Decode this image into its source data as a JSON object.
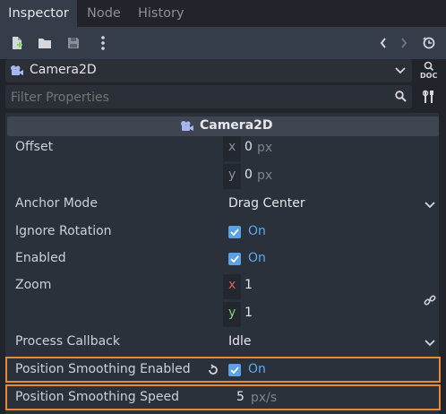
{
  "tabs": [
    {
      "label": "Inspector"
    },
    {
      "label": "Node"
    },
    {
      "label": "History"
    }
  ],
  "toolbar": {
    "icons": [
      "new-resource-icon",
      "open-folder-icon",
      "save-icon",
      "more-vertical-icon",
      "back-icon",
      "forward-icon",
      "history-icon"
    ]
  },
  "object": {
    "name": "Camera2D",
    "doc_label": "DOC"
  },
  "filter": {
    "placeholder": "Filter Properties"
  },
  "section": {
    "title": "Camera2D"
  },
  "properties": {
    "offset": {
      "label": "Offset",
      "x_axis": "x",
      "x": "0",
      "y_axis": "y",
      "y": "0",
      "unit": "px"
    },
    "anchor_mode": {
      "label": "Anchor Mode",
      "value": "Drag Center"
    },
    "ignore_rotation": {
      "label": "Ignore Rotation",
      "value": "On"
    },
    "enabled": {
      "label": "Enabled",
      "value": "On"
    },
    "zoom": {
      "label": "Zoom",
      "x_axis": "x",
      "x": "1",
      "y_axis": "y",
      "y": "1"
    },
    "process_callback": {
      "label": "Process Callback",
      "value": "Idle"
    },
    "position_smoothing_enabled": {
      "label": "Position Smoothing Enabled",
      "value": "On"
    },
    "position_smoothing_speed": {
      "label": "Position Smoothing Speed",
      "value": "5",
      "unit": "px/s"
    }
  },
  "colors": {
    "accent": "#5aa1e8",
    "highlight": "#e58a35",
    "axis_x": "#e0605a",
    "axis_y": "#8bd17c"
  }
}
